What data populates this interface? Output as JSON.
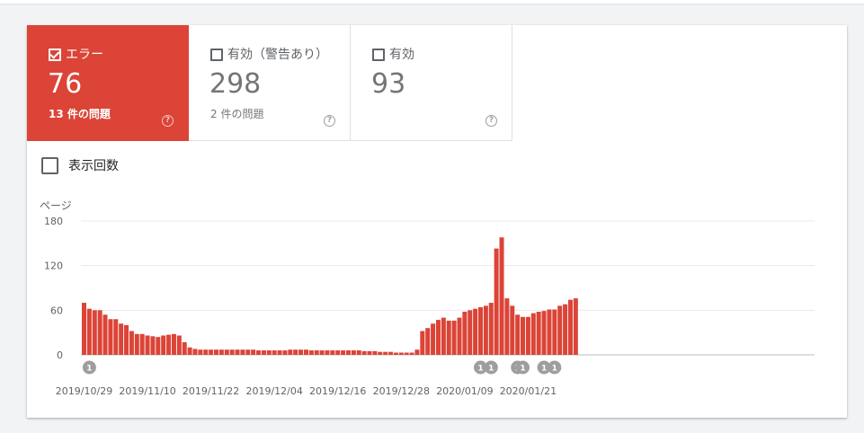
{
  "tiles": [
    {
      "label": "エラー",
      "count": "76",
      "subtitle": "13 件の問題",
      "checked": true
    },
    {
      "label": "有効（警告あり）",
      "count": "298",
      "subtitle": "2 件の問題",
      "checked": false
    },
    {
      "label": "有効",
      "count": "93",
      "subtitle": "",
      "checked": false
    }
  ],
  "impressions": {
    "label": "表示回数",
    "checked": false
  },
  "colors": {
    "error": "#db4437",
    "marker": "#9e9e9e"
  },
  "chart_data": {
    "type": "bar",
    "ylabel": "ページ",
    "ylim": [
      0,
      180
    ],
    "yticks": [
      0,
      60,
      120,
      180
    ],
    "xtick_labels": [
      "2019/10/29",
      "2019/11/10",
      "2019/11/22",
      "2019/12/04",
      "2019/12/16",
      "2019/12/28",
      "2020/01/09",
      "2020/01/21"
    ],
    "start_date": "2019/10/29",
    "values": [
      70,
      62,
      60,
      60,
      54,
      48,
      48,
      42,
      40,
      32,
      28,
      28,
      26,
      25,
      24,
      26,
      27,
      28,
      26,
      17,
      10,
      8,
      7,
      7,
      7,
      7,
      7,
      7,
      7,
      7,
      7,
      7,
      7,
      6,
      6,
      6,
      6,
      6,
      6,
      7,
      7,
      7,
      7,
      6,
      6,
      6,
      6,
      6,
      6,
      6,
      6,
      6,
      6,
      5,
      5,
      5,
      4,
      4,
      4,
      3,
      3,
      3,
      3,
      7,
      32,
      36,
      42,
      47,
      50,
      46,
      46,
      50,
      58,
      60,
      62,
      64,
      66,
      70,
      143,
      158,
      76,
      66,
      54,
      51,
      51,
      56,
      58,
      59,
      61,
      61,
      66,
      68,
      74,
      76
    ],
    "annotations": [
      {
        "day": "2019/10/30",
        "label": "1"
      },
      {
        "day": "2020/01/12",
        "label": "1"
      },
      {
        "day": "2020/01/14",
        "label": "1"
      },
      {
        "day": "2020/01/19",
        "label": "1"
      },
      {
        "day": "2020/01/20",
        "label": "1"
      },
      {
        "day": "2020/01/24",
        "label": "1"
      },
      {
        "day": "2020/01/26",
        "label": "1"
      }
    ]
  }
}
